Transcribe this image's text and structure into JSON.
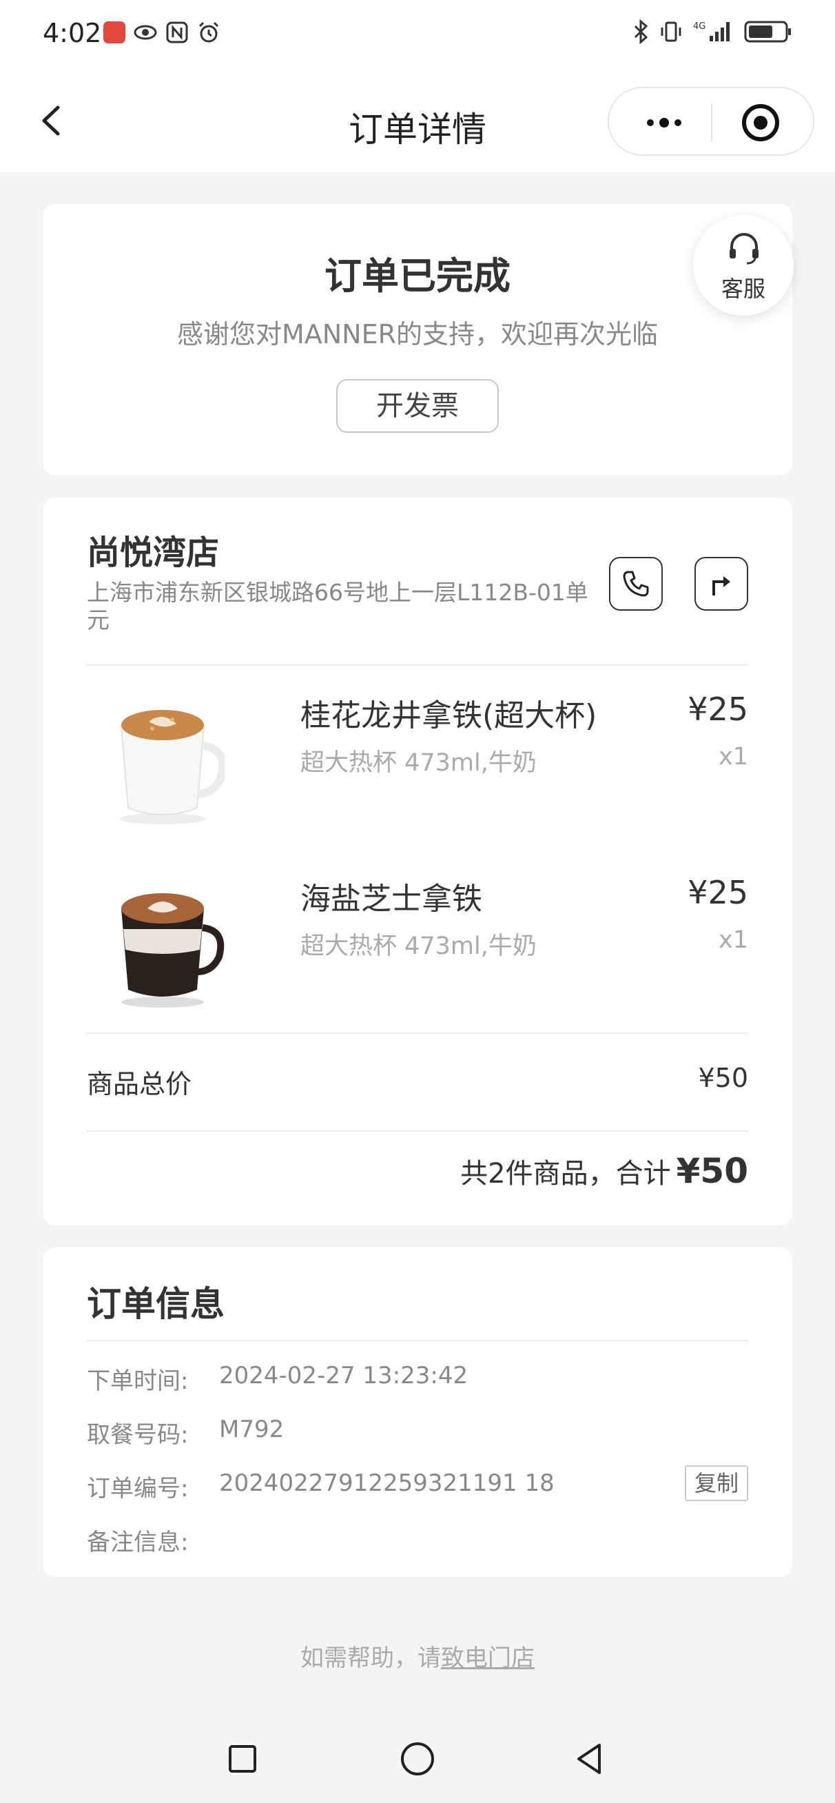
{
  "status_bar": {
    "time": "4:02",
    "left_icons": [
      "notification-badge-icon",
      "eye-icon",
      "nfc-icon",
      "alarm-icon"
    ],
    "right_icons": [
      "bluetooth-icon",
      "vibrate-icon",
      "signal-4g-icon",
      "battery-icon"
    ]
  },
  "nav": {
    "title": "订单详情",
    "back_icon": "back-arrow-icon",
    "more_icon": "more-dots-icon",
    "close_icon": "target-circle-icon"
  },
  "order_status": {
    "title": "订单已完成",
    "subtitle": "感谢您对MANNER的支持，欢迎再次光临",
    "invoice_button": "开发票"
  },
  "customer_service": {
    "label": "客服",
    "icon": "headset-icon"
  },
  "store": {
    "name": "尚悦湾店",
    "address": "上海市浦东新区银城路66号地上一层L112B-01单元",
    "phone_icon": "phone-icon",
    "navigate_icon": "navigate-icon"
  },
  "products": [
    {
      "name": "桂花龙井拿铁(超大杯)",
      "spec": "超大热杯 473ml,牛奶",
      "price": "¥25",
      "qty": "x1"
    },
    {
      "name": "海盐芝士拿铁",
      "spec": "超大热杯 473ml,牛奶",
      "price": "¥25",
      "qty": "x1"
    }
  ],
  "summary": {
    "subtotal_label": "商品总价",
    "subtotal_value": "¥50",
    "total_prefix": "共2件商品，合计",
    "total_amount": "¥50"
  },
  "order_info": {
    "title": "订单信息",
    "rows": [
      {
        "label": "下单时间:",
        "value": "2024-02-27 13:23:42"
      },
      {
        "label": "取餐号码:",
        "value": "M792"
      },
      {
        "label": "订单编号:",
        "value": "20240227912259321191 18"
      },
      {
        "label": "备注信息:",
        "value": ""
      }
    ],
    "copy_button": "复制"
  },
  "help": {
    "prefix": "如需帮助，请",
    "link": "致电门店"
  },
  "system_nav": {
    "icons": [
      "recent-apps-icon",
      "home-icon",
      "back-icon"
    ]
  },
  "colors": {
    "background": "#f4f4f4",
    "card": "#ffffff",
    "text_primary": "#333333",
    "text_secondary": "#888888",
    "text_muted": "#aaaaaa",
    "badge_red": "#e2483b"
  }
}
